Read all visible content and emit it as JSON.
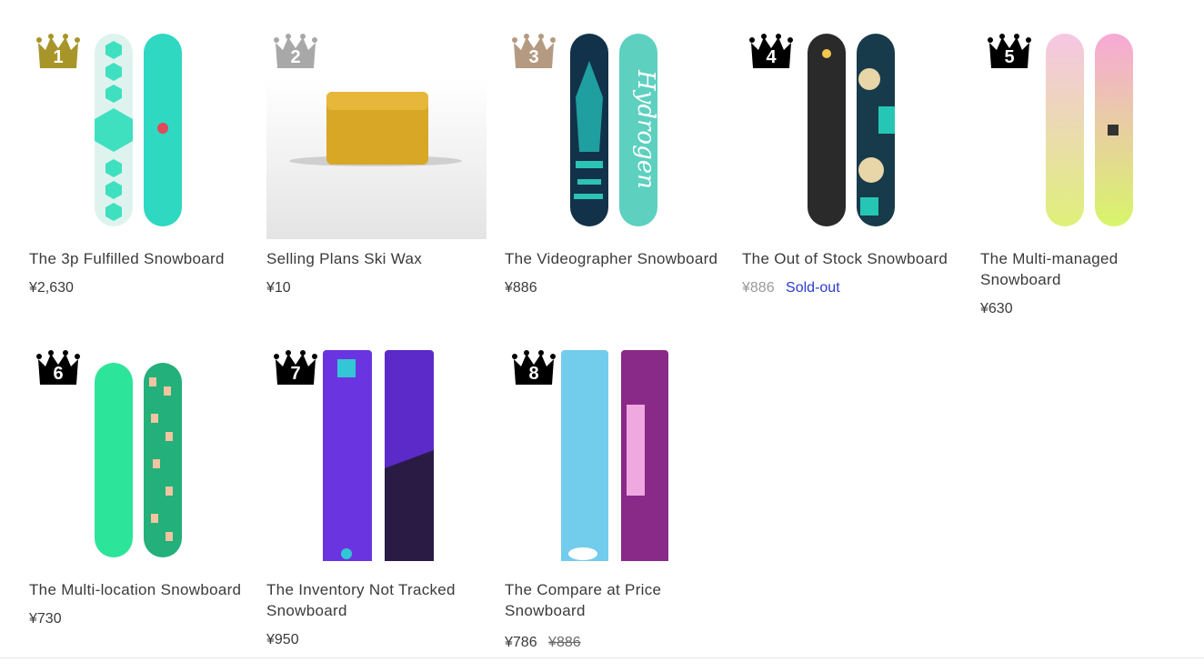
{
  "products": [
    {
      "rank": "1",
      "title": "The 3p Fulfilled Snowboard",
      "price": "¥2,630",
      "price_compare": "",
      "status": "",
      "crown_color": "#a8952a",
      "image": "snowboard-pair"
    },
    {
      "rank": "2",
      "title": "Selling Plans Ski Wax",
      "price": "¥10",
      "price_compare": "",
      "status": "",
      "crown_color": "#a8a8a8",
      "image": "ski-wax"
    },
    {
      "rank": "3",
      "title": "The Videographer Snowboard",
      "price": "¥886",
      "price_compare": "",
      "status": "",
      "crown_color": "#b59a82",
      "image": "snowboard-pair"
    },
    {
      "rank": "4",
      "title": "The Out of Stock Snowboard",
      "price": "¥886",
      "price_compare": "",
      "status": "Sold-out",
      "crown_color": "#000000",
      "image": "snowboard-pair"
    },
    {
      "rank": "5",
      "title_line1": "The Multi-managed",
      "title_line2": "Snowboard",
      "price": "¥630",
      "price_compare": "",
      "status": "",
      "crown_color": "#000000",
      "image": "snowboard-pair"
    },
    {
      "rank": "6",
      "title": "The Multi-location Snowboard",
      "price": "¥730",
      "price_compare": "",
      "status": "",
      "crown_color": "#000000",
      "image": "snowboard-pair"
    },
    {
      "rank": "7",
      "title_line1": "The Inventory Not Tracked",
      "title_line2": "Snowboard",
      "price": "¥950",
      "price_compare": "",
      "status": "",
      "crown_color": "#000000",
      "image": "snowboard-pair"
    },
    {
      "rank": "8",
      "title_line1": "The Compare at Price",
      "title_line2": "Snowboard",
      "price": "¥786",
      "price_compare": "¥886",
      "status": "",
      "crown_color": "#000000",
      "image": "snowboard-pair"
    }
  ]
}
